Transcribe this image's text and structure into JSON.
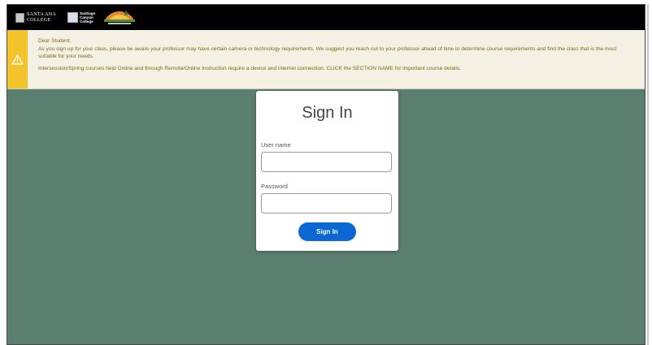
{
  "header": {
    "logo_sac_text": "SANTA ANA\nCOLLEGE",
    "logo_scc_text": "Santiago\nCanyon\nCollege"
  },
  "alert": {
    "greeting": "Dear Student,",
    "message": "As you sign up for your class, please be aware your professor may have certain camera or technology requirements. We suggest you reach out to your professor ahead of time to determine course requirements and find the class that is the most suitable for your needs.",
    "message2": "Intersession/Spring courses held Online and through Remote/Online Instruction require a device and internet connection. CLICK the SECTION NAME for important course details.",
    "accent_color": "#f4c32c"
  },
  "signin": {
    "title": "Sign In",
    "username_label": "User name",
    "username_value": "",
    "password_label": "Password",
    "password_value": "",
    "button_label": "Sign In",
    "button_color": "#0b67d1"
  },
  "page": {
    "background_color": "#5a7f70"
  }
}
